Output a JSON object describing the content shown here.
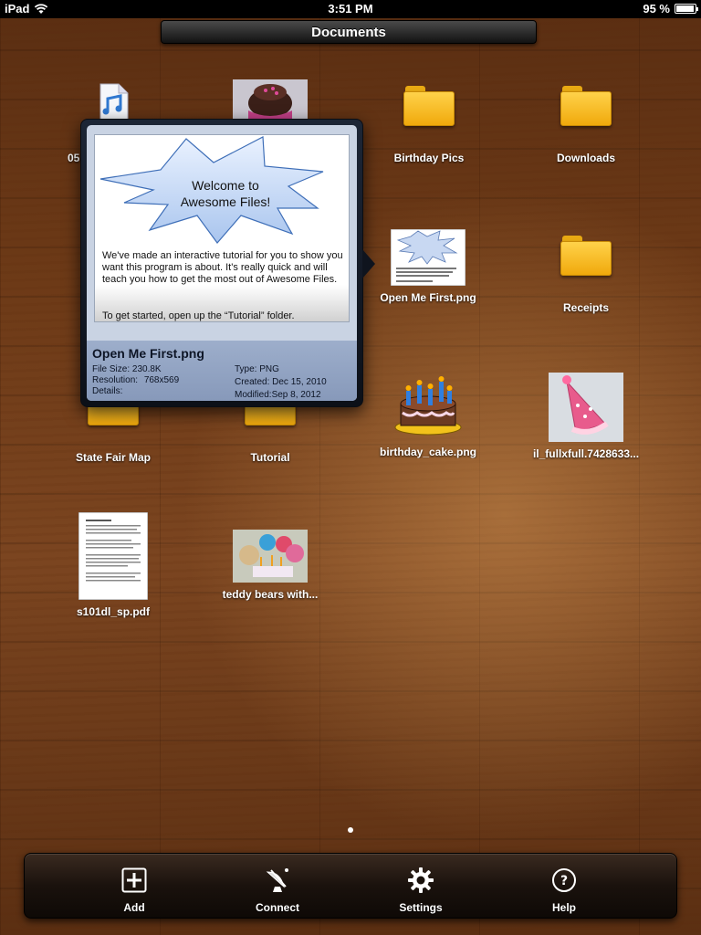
{
  "status_bar": {
    "device": "iPad",
    "time": "3:51 PM",
    "battery": "95 %",
    "battery_level": 0.95
  },
  "title_bar": {
    "title": "Documents"
  },
  "items": {
    "item_05": {
      "label": "05"
    },
    "birthday_pics": {
      "label": "Birthday Pics"
    },
    "downloads": {
      "label": "Downloads"
    },
    "open_me_first": {
      "label": "Open Me First.png"
    },
    "receipts": {
      "label": "Receipts"
    },
    "state_fair_map": {
      "label": "State Fair Map"
    },
    "tutorial": {
      "label": "Tutorial"
    },
    "birthday_cake": {
      "label": "birthday_cake.png"
    },
    "il_fullxfull": {
      "label": "il_fullxfull.7428633..."
    },
    "s101dl": {
      "label": "s101dl_sp.pdf"
    },
    "teddy_bears": {
      "label": "teddy bears with..."
    }
  },
  "popover": {
    "preview": {
      "burst_line1": "Welcome to",
      "burst_line2": "Awesome Files!",
      "paragraph": "We've made an interactive tutorial for you to show you want this program is about.  It's really quick and will teach you how to get the most out of Awesome Files.",
      "paragraph2": "To get started, open up the “Tutorial” folder."
    },
    "file_name": "Open Me First.png",
    "file_size_label": "File Size:",
    "file_size": "230.8K",
    "resolution_label": "Resolution:",
    "resolution": "768x569",
    "details_label": "Details:",
    "type_label": "Type:",
    "type": "PNG",
    "created_label": "Created:",
    "created": "Dec 15, 2010",
    "modified_label": "Modified:",
    "modified": "Sep 8, 2012"
  },
  "toolbar": {
    "add": "Add",
    "connect": "Connect",
    "settings": "Settings",
    "help": "Help"
  },
  "colors": {
    "folder": "#f5b820",
    "toolbar_bg": "#1a120d",
    "popover_info": "#9daecb"
  }
}
